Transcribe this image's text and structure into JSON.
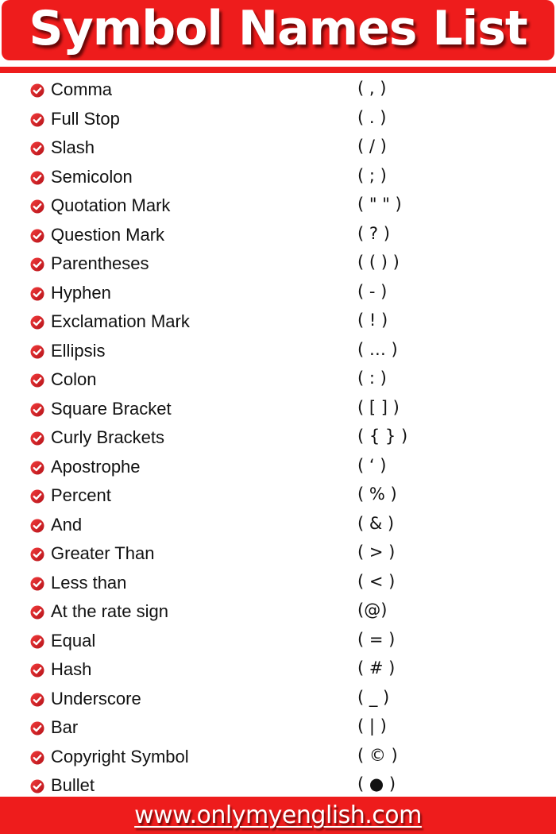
{
  "header": {
    "title": "Symbol Names List"
  },
  "colors": {
    "accent": "#ee1c1c",
    "text": "#111111",
    "header_text": "#ffffff"
  },
  "list_icon": "check-circle-icon",
  "items": [
    {
      "name": "Comma",
      "symbol": "( , )"
    },
    {
      "name": "Full Stop",
      "symbol": "( . )"
    },
    {
      "name": "Slash",
      "symbol": "( / )"
    },
    {
      "name": "Semicolon",
      "symbol": "( ; )"
    },
    {
      "name": "Quotation Mark",
      "symbol": "( \" \" )"
    },
    {
      "name": "Question Mark",
      "symbol": "( ? )"
    },
    {
      "name": "Parentheses",
      "symbol": "( ( ) )"
    },
    {
      "name": "Hyphen",
      "symbol": "( - )"
    },
    {
      "name": "Exclamation Mark",
      "symbol": "( ! )"
    },
    {
      "name": "Ellipsis",
      "symbol": "( … )"
    },
    {
      "name": "Colon",
      "symbol": "( : )"
    },
    {
      "name": "Square Bracket",
      "symbol": "( [ ] )"
    },
    {
      "name": "Curly Brackets",
      "symbol": "( { } )"
    },
    {
      "name": "Apostrophe",
      "symbol": "( ‘ )"
    },
    {
      "name": "Percent",
      "symbol": "( % )"
    },
    {
      "name": "And",
      "symbol": "( & )"
    },
    {
      "name": "Greater Than",
      "symbol": "( > )"
    },
    {
      "name": "Less than",
      "symbol": "( < )"
    },
    {
      "name": "At the rate sign",
      "symbol": "(@)"
    },
    {
      "name": "Equal",
      "symbol": "( = )"
    },
    {
      "name": "Hash",
      "symbol": "( # )"
    },
    {
      "name": "Underscore",
      "symbol": "( _ )"
    },
    {
      "name": "Bar",
      "symbol": "( | )"
    },
    {
      "name": "Copyright Symbol",
      "symbol": "( © )"
    },
    {
      "name": "Bullet",
      "symbol": "( ● )"
    }
  ],
  "footer": {
    "website": "www.onlymyenglish.com"
  }
}
